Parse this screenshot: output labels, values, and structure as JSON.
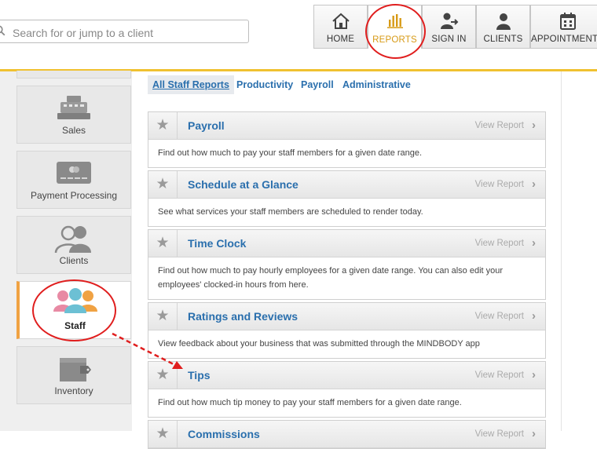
{
  "search": {
    "placeholder": "Search for or jump to a client"
  },
  "nav": [
    {
      "id": "home",
      "label": "HOME",
      "icon": "home-icon"
    },
    {
      "id": "reports",
      "label": "REPORTS",
      "icon": "bar-chart-icon",
      "active": true
    },
    {
      "id": "signin",
      "label": "SIGN IN",
      "icon": "sign-in-icon"
    },
    {
      "id": "clients",
      "label": "CLIENTS",
      "icon": "person-icon"
    },
    {
      "id": "appointments",
      "label": "APPOINTMENTS",
      "icon": "calendar-icon"
    }
  ],
  "categories": [
    {
      "id": "sales",
      "label": "Sales",
      "icon": "cash-register-icon"
    },
    {
      "id": "payment",
      "label": "Payment Processing",
      "icon": "credit-card-icon"
    },
    {
      "id": "clients",
      "label": "Clients",
      "icon": "people-icon"
    },
    {
      "id": "staff",
      "label": "Staff",
      "icon": "staff-group-icon",
      "active": true
    },
    {
      "id": "inventory",
      "label": "Inventory",
      "icon": "box-tag-icon"
    }
  ],
  "subtabs": [
    "All Staff Reports",
    "Productivity",
    "Payroll",
    "Administrative"
  ],
  "view_report_label": "View Report",
  "reports": [
    {
      "title": "Payroll",
      "desc": "Find out how much to pay your staff members for a given date range."
    },
    {
      "title": "Schedule at a Glance",
      "desc": "See what services your staff members are scheduled to render today."
    },
    {
      "title": "Time Clock",
      "desc": "Find out how much to pay hourly employees for a given date range. You can also edit your employees' clocked-in hours from here."
    },
    {
      "title": "Ratings and Reviews",
      "desc": "View feedback about your business that was submitted through the MINDBODY app"
    },
    {
      "title": "Tips",
      "desc": "Find out how much tip money to pay your staff members for a given date range."
    },
    {
      "title": "Commissions",
      "desc": ""
    }
  ],
  "colors": {
    "accent": "#f0c130",
    "link": "#2a6fad",
    "annotation": "#e01e1e",
    "active_tab": "#d79a16"
  }
}
